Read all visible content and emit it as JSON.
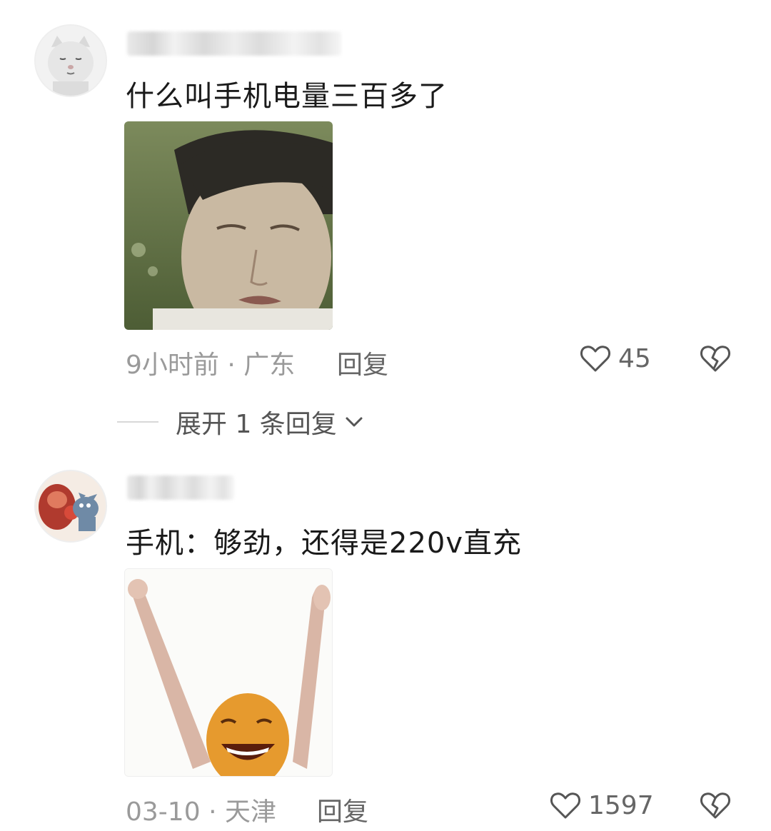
{
  "comments": [
    {
      "text": "什么叫手机电量三百多了",
      "time": "9小时前",
      "location": "广东",
      "reply_label": "回复",
      "likes": "45"
    },
    {
      "text": "手机：够劲，还得是220v直充",
      "time": "03-10",
      "location": "天津",
      "reply_label": "回复",
      "likes": "1597"
    }
  ],
  "expand_replies_label": "展开 1 条回复",
  "icons": {
    "like": "heart-outline-icon",
    "dislike": "broken-heart-icon",
    "expand": "chevron-down-icon"
  },
  "colors": {
    "meta_text": "#9a9a9a",
    "action_text": "#666666",
    "icon_stroke": "#555555"
  }
}
